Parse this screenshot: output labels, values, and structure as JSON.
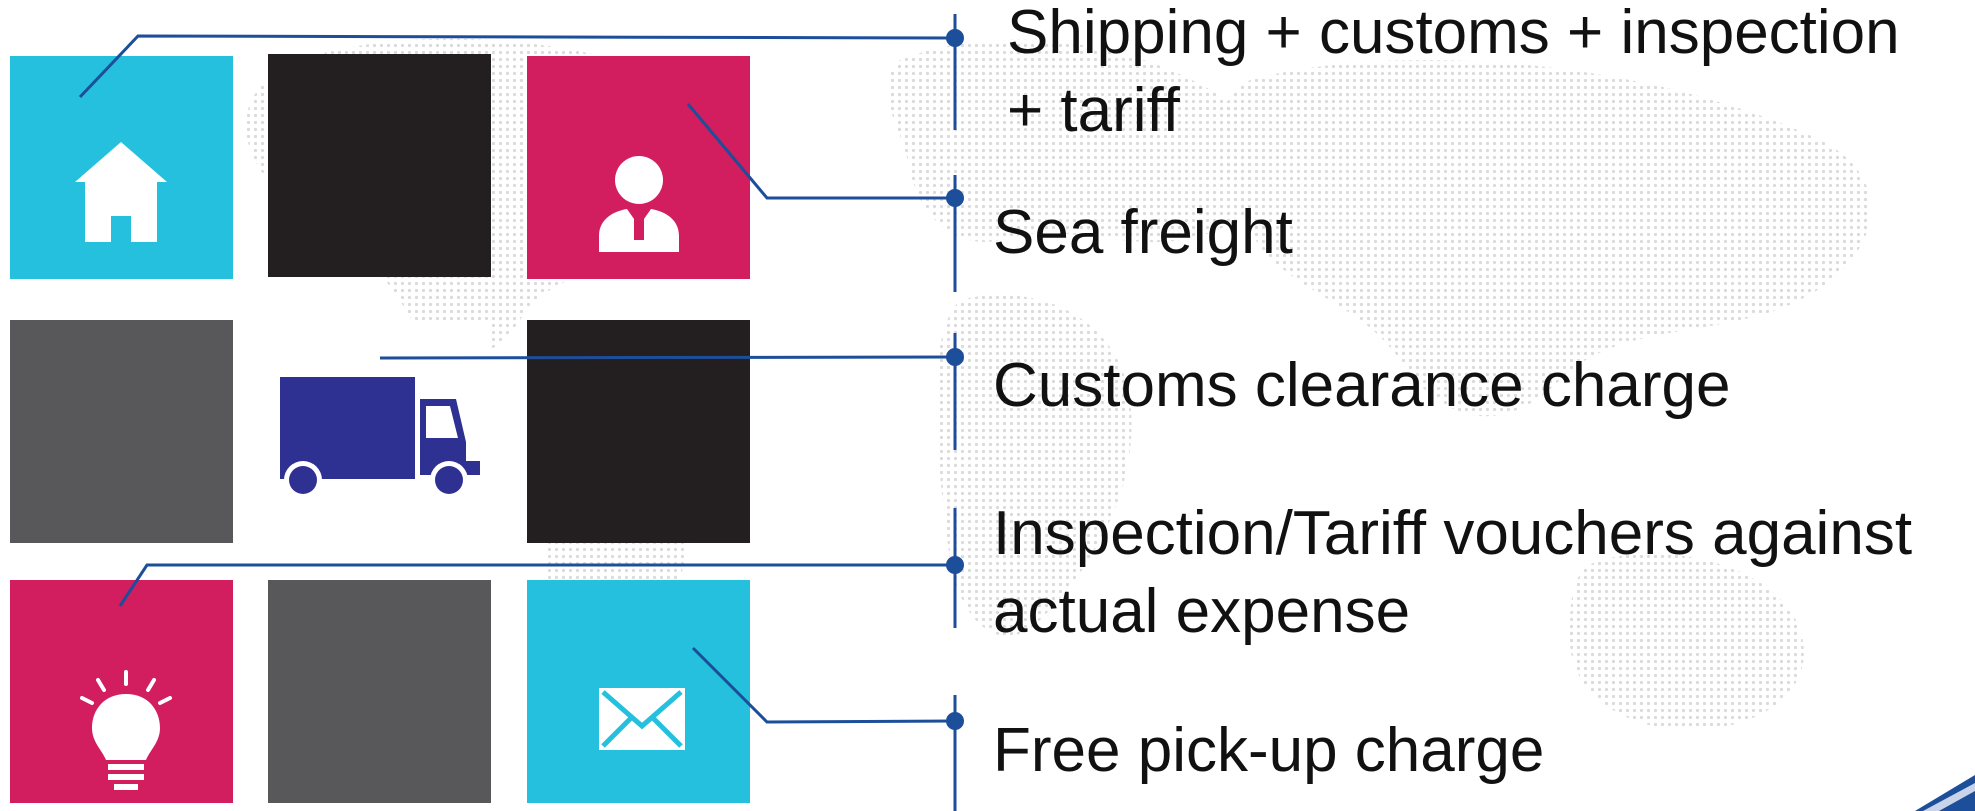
{
  "colors": {
    "cyan": "#25c0de",
    "magenta": "#d21d5e",
    "black": "#231f20",
    "gray": "#58585a",
    "navy": "#2e3192",
    "line": "#1d4e9a"
  },
  "tiles": [
    {
      "row": 1,
      "col": 1,
      "color": "cyan",
      "icon": "house-icon"
    },
    {
      "row": 1,
      "col": 2,
      "color": "black",
      "icon": ""
    },
    {
      "row": 1,
      "col": 3,
      "color": "magenta",
      "icon": "person-icon"
    },
    {
      "row": 2,
      "col": 1,
      "color": "gray",
      "icon": ""
    },
    {
      "row": 2,
      "col": 2,
      "color": "white",
      "icon": "truck-icon"
    },
    {
      "row": 2,
      "col": 3,
      "color": "black",
      "icon": ""
    },
    {
      "row": 3,
      "col": 1,
      "color": "magenta",
      "icon": "lightbulb-icon"
    },
    {
      "row": 3,
      "col": 2,
      "color": "gray",
      "icon": ""
    },
    {
      "row": 3,
      "col": 3,
      "color": "cyan",
      "icon": "envelope-icon"
    }
  ],
  "items": [
    {
      "line1": "Shipping + customs + inspection",
      "line2": "+ tariff"
    },
    {
      "line1": "Sea freight",
      "line2": ""
    },
    {
      "line1": "Customs clearance charge",
      "line2": ""
    },
    {
      "line1": "Inspection/Tariff vouchers against",
      "line2": "actual expense"
    },
    {
      "line1": "Free pick-up charge",
      "line2": ""
    }
  ]
}
